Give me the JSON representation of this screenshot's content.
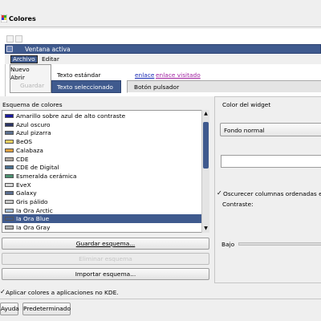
{
  "header": {
    "title": "Colores",
    "icon": "colors-app-icon"
  },
  "preview": {
    "window_title": "Ventana activa",
    "menu": [
      "Archivo",
      "Editar"
    ],
    "dropdown_items": [
      "Nuevo",
      "Abrir",
      "Guardar"
    ],
    "standard_text": "Texto estándar",
    "link_text": "enlace",
    "visited_link_text": "enlace visitado",
    "selected_text": "Texto seleccionado",
    "push_button": "Botón pulsador"
  },
  "scheme": {
    "label": "Esquema de colores",
    "items": [
      {
        "label": "Amarillo sobre azul de alto contraste",
        "swatch": "#1a1aa0"
      },
      {
        "label": "Azul oscuro",
        "swatch": "#2b3566"
      },
      {
        "label": "Azul pizarra",
        "swatch": "#5c7090"
      },
      {
        "label": "BeOS",
        "swatch": "#f0d060"
      },
      {
        "label": "Calabaza",
        "swatch": "#e0a040"
      },
      {
        "label": "CDE",
        "swatch": "#b0a8a0"
      },
      {
        "label": "CDE de Digital",
        "swatch": "#4a7090"
      },
      {
        "label": "Esmeralda cerámica",
        "swatch": "#4a9070"
      },
      {
        "label": "EveX",
        "swatch": "#d8d8d8"
      },
      {
        "label": "Galaxy",
        "swatch": "#5a6e90"
      },
      {
        "label": "Gris pálido",
        "swatch": "#c8c8c8"
      },
      {
        "label": "Ia Ora Arctic",
        "swatch": "#a8c0d8"
      },
      {
        "label": "Ia Ora Blue",
        "swatch": "#3f5a8e"
      },
      {
        "label": "Ia Ora Gray",
        "swatch": "#b0b0b0"
      }
    ],
    "selected_index": 12,
    "buttons": {
      "save": "Guardar esquema...",
      "delete": "Eliminar esquema",
      "import": "Importar esquema..."
    }
  },
  "widget": {
    "label": "Color del widget",
    "combo_value": "Fondo normal",
    "shade_columns": "Oscurecer columnas ordenadas en",
    "contrast_label": "Contraste:",
    "low_label": "Bajo"
  },
  "bottom": {
    "apply_kde": "Aplicar colores a aplicaciones no KDE.",
    "help": "Ayuda",
    "defaults": "Predeterminado"
  },
  "colors": {
    "accent": "#3f5a8e",
    "link": "#1a2ab5",
    "visited": "#a020a0"
  }
}
